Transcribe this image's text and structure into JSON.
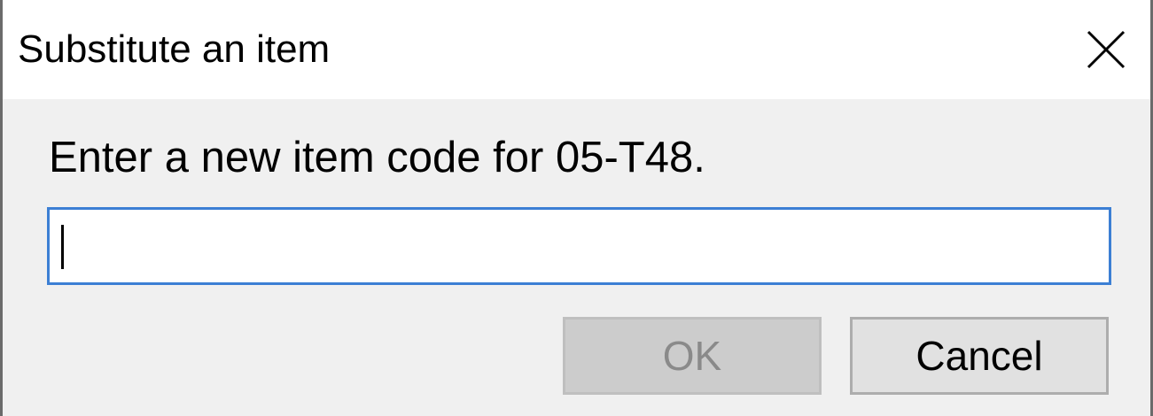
{
  "dialog": {
    "title": "Substitute an item",
    "close_icon": "close-icon",
    "prompt": "Enter a new item code for 05-T48.",
    "input": {
      "value": "",
      "placeholder": ""
    },
    "buttons": {
      "ok_label": "OK",
      "ok_enabled": false,
      "cancel_label": "Cancel"
    }
  },
  "colors": {
    "titlebar_bg": "#ffffff",
    "dialog_bg": "#f0f0f0",
    "input_focus_border": "#3c7fd4",
    "disabled_button_bg": "#cccccc",
    "disabled_button_text": "#8a8a8a",
    "button_bg": "#e1e1e1",
    "button_border": "#adadad"
  }
}
